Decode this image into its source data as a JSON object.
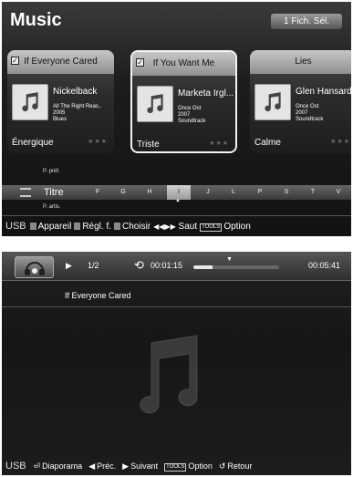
{
  "browser": {
    "title": "Music",
    "selected_button": "1 Fich. Sél.",
    "cards": [
      {
        "title": "If Everyone Cared",
        "artist": "Nickelback",
        "album": "All The Right Reas..",
        "year": "2005",
        "genre": "Blues",
        "mood": "Énergique",
        "checked": true,
        "selected": false
      },
      {
        "title": "If You Want Me",
        "artist": "Marketa Irgl...",
        "album": "Once Ost",
        "year": "2007",
        "genre": "Soundtrack",
        "mood": "Triste",
        "checked": true,
        "selected": true
      },
      {
        "title": "Lies",
        "artist": "Glen Hansard",
        "album": "Once Ost",
        "year": "2007",
        "genre": "Soundtrack",
        "mood": "Calme",
        "checked": false,
        "selected": false
      }
    ],
    "stars": "★★★",
    "sort": {
      "prev": "P. préf.",
      "current": "Titre",
      "next": "P. artis."
    },
    "letters": [
      "F",
      "G",
      "H",
      "I",
      "J",
      "L",
      "P",
      "S",
      "T",
      "V"
    ],
    "active_letter": "I",
    "footer": {
      "source": "USB",
      "appareil": "Appareil",
      "regl": "Régl. f.",
      "choisir": "Choisir",
      "saut": "Saut",
      "tools": "TOOLS",
      "option": "Option"
    }
  },
  "player": {
    "track_index": "1/2",
    "elapsed": "00:01:15",
    "total": "00:05:41",
    "progress": 0.22,
    "song_title": "If Everyone Cared",
    "footer": {
      "source": "USB",
      "diaporama": "Diaporama",
      "prec": "Préc.",
      "suivant": "Suivant",
      "tools": "TOOLS",
      "option": "Option",
      "retour": "Retour"
    }
  },
  "icons": {
    "note": "music-note-icon",
    "headphones": "headphones-icon",
    "play": "play-icon",
    "repeat": "repeat-icon"
  }
}
